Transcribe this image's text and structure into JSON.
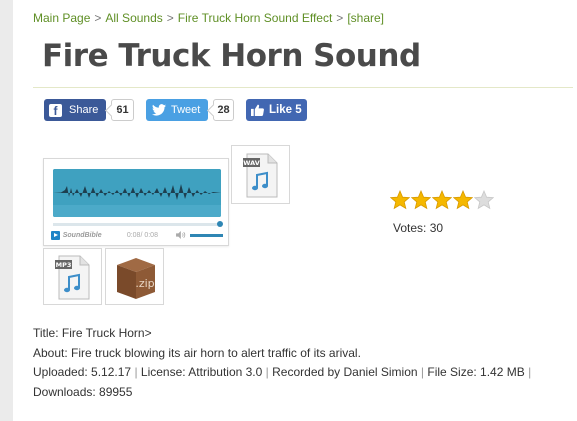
{
  "breadcrumb": {
    "items": [
      "Main Page",
      "All Sounds",
      "Fire Truck Horn Sound Effect",
      "[share]"
    ],
    "separator": ">"
  },
  "page": {
    "title": "Fire Truck Horn Sound"
  },
  "social": {
    "facebook": {
      "label": "Share",
      "count": "61",
      "color": "#3b5998"
    },
    "twitter": {
      "label": "Tweet",
      "count": "28",
      "color": "#4aa0e3"
    },
    "like": {
      "label": "Like 5",
      "color": "#4267b2"
    }
  },
  "player": {
    "brand": "SoundBible",
    "time": "0:08/ 0:08",
    "progress": 1.0,
    "volume": 1.0,
    "waveform_color": "#3fa1c0"
  },
  "downloads": {
    "wav_label": "WAV",
    "mp3_label": "MP3",
    "zip_label": ".zip"
  },
  "rating": {
    "stars_filled": 4,
    "stars_total": 5,
    "votes_text": "Votes: 30"
  },
  "info": {
    "title": "Title: Fire Truck Horn>",
    "about": "About: Fire truck blowing its air horn to alert traffic of its arival.",
    "uploaded": "Uploaded: 5.12.17",
    "license": "License: Attribution 3.0",
    "recorded_by": "Recorded by Daniel Simion",
    "file_size": "File Size: 1.42 MB",
    "downloads": "Downloads: 89955",
    "separator": "|"
  },
  "colors": {
    "link_green": "#5f8f25",
    "star_gold": "#f5b800",
    "star_empty": "#dddddd"
  }
}
